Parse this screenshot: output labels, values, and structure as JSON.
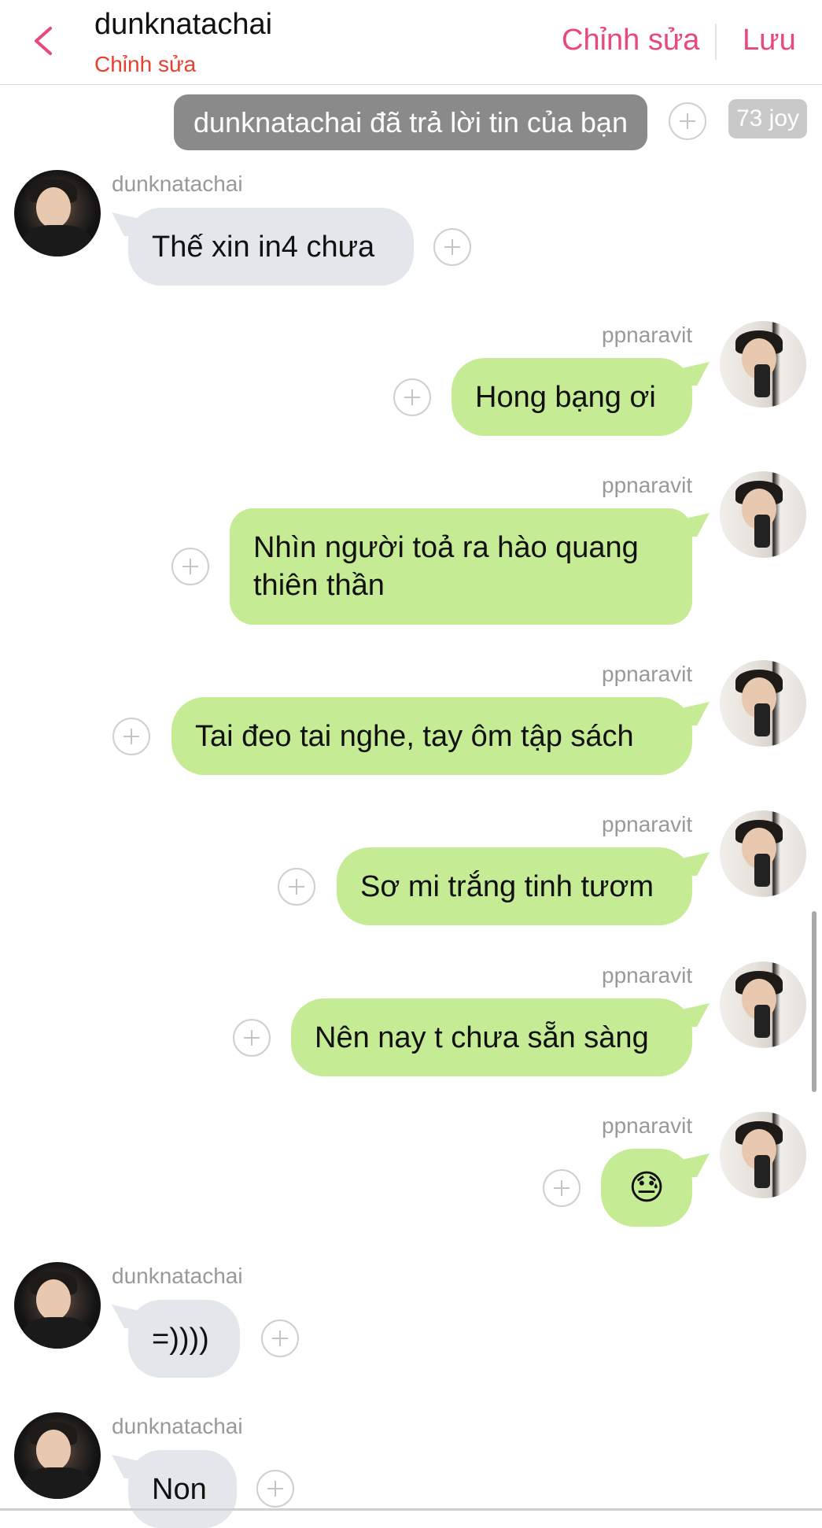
{
  "header": {
    "title": "dunknatachai",
    "subtitle": "Chỉnh sửa",
    "edit_label": "Chỉnh sửa",
    "save_label": "Lưu",
    "accent": "#e8487c",
    "subtitle_color": "#e8402f"
  },
  "system_notice": {
    "text": "dunknatachai đã trả lời tin của bạn",
    "badge": "73 joy"
  },
  "messages": [
    {
      "sender": "dunknatachai",
      "side": "incoming",
      "text": "Thế xin in4 chưa"
    },
    {
      "sender": "ppnaravit",
      "side": "outgoing",
      "text": "Hong bạng ơi"
    },
    {
      "sender": "ppnaravit",
      "side": "outgoing",
      "text": "Nhìn người toả ra hào quang thiên thần",
      "lines": [
        "Nhìn người toả ra hào quang",
        "thiên thần"
      ]
    },
    {
      "sender": "ppnaravit",
      "side": "outgoing",
      "text": "Tai đeo tai nghe, tay ôm tập sách"
    },
    {
      "sender": "ppnaravit",
      "side": "outgoing",
      "text": "Sơ mi trắng tinh tươm"
    },
    {
      "sender": "ppnaravit",
      "side": "outgoing",
      "text": "Nên nay t chưa sẵn sàng"
    },
    {
      "sender": "ppnaravit",
      "side": "outgoing",
      "text": "😓"
    },
    {
      "sender": "dunknatachai",
      "side": "incoming",
      "text": "=))))"
    },
    {
      "sender": "dunknatachai",
      "side": "incoming",
      "text": "Non"
    }
  ],
  "icons": {
    "back": "chevron-left-icon",
    "add_reaction": "plus-circle-icon"
  },
  "colors": {
    "incoming_bubble": "#e3e6ea",
    "outgoing_bubble": "#c6eb95",
    "system_pill": "#8a8a8a"
  }
}
